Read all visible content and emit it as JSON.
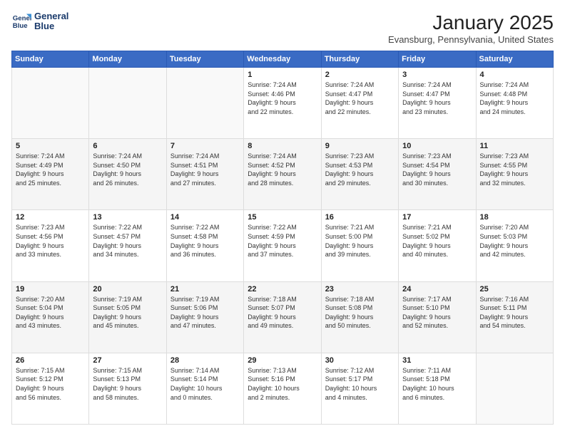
{
  "header": {
    "logo_line1": "General",
    "logo_line2": "Blue",
    "title": "January 2025",
    "subtitle": "Evansburg, Pennsylvania, United States"
  },
  "days_of_week": [
    "Sunday",
    "Monday",
    "Tuesday",
    "Wednesday",
    "Thursday",
    "Friday",
    "Saturday"
  ],
  "weeks": [
    [
      {
        "day": "",
        "details": ""
      },
      {
        "day": "",
        "details": ""
      },
      {
        "day": "",
        "details": ""
      },
      {
        "day": "1",
        "details": "Sunrise: 7:24 AM\nSunset: 4:46 PM\nDaylight: 9 hours\nand 22 minutes."
      },
      {
        "day": "2",
        "details": "Sunrise: 7:24 AM\nSunset: 4:47 PM\nDaylight: 9 hours\nand 22 minutes."
      },
      {
        "day": "3",
        "details": "Sunrise: 7:24 AM\nSunset: 4:47 PM\nDaylight: 9 hours\nand 23 minutes."
      },
      {
        "day": "4",
        "details": "Sunrise: 7:24 AM\nSunset: 4:48 PM\nDaylight: 9 hours\nand 24 minutes."
      }
    ],
    [
      {
        "day": "5",
        "details": "Sunrise: 7:24 AM\nSunset: 4:49 PM\nDaylight: 9 hours\nand 25 minutes."
      },
      {
        "day": "6",
        "details": "Sunrise: 7:24 AM\nSunset: 4:50 PM\nDaylight: 9 hours\nand 26 minutes."
      },
      {
        "day": "7",
        "details": "Sunrise: 7:24 AM\nSunset: 4:51 PM\nDaylight: 9 hours\nand 27 minutes."
      },
      {
        "day": "8",
        "details": "Sunrise: 7:24 AM\nSunset: 4:52 PM\nDaylight: 9 hours\nand 28 minutes."
      },
      {
        "day": "9",
        "details": "Sunrise: 7:23 AM\nSunset: 4:53 PM\nDaylight: 9 hours\nand 29 minutes."
      },
      {
        "day": "10",
        "details": "Sunrise: 7:23 AM\nSunset: 4:54 PM\nDaylight: 9 hours\nand 30 minutes."
      },
      {
        "day": "11",
        "details": "Sunrise: 7:23 AM\nSunset: 4:55 PM\nDaylight: 9 hours\nand 32 minutes."
      }
    ],
    [
      {
        "day": "12",
        "details": "Sunrise: 7:23 AM\nSunset: 4:56 PM\nDaylight: 9 hours\nand 33 minutes."
      },
      {
        "day": "13",
        "details": "Sunrise: 7:22 AM\nSunset: 4:57 PM\nDaylight: 9 hours\nand 34 minutes."
      },
      {
        "day": "14",
        "details": "Sunrise: 7:22 AM\nSunset: 4:58 PM\nDaylight: 9 hours\nand 36 minutes."
      },
      {
        "day": "15",
        "details": "Sunrise: 7:22 AM\nSunset: 4:59 PM\nDaylight: 9 hours\nand 37 minutes."
      },
      {
        "day": "16",
        "details": "Sunrise: 7:21 AM\nSunset: 5:00 PM\nDaylight: 9 hours\nand 39 minutes."
      },
      {
        "day": "17",
        "details": "Sunrise: 7:21 AM\nSunset: 5:02 PM\nDaylight: 9 hours\nand 40 minutes."
      },
      {
        "day": "18",
        "details": "Sunrise: 7:20 AM\nSunset: 5:03 PM\nDaylight: 9 hours\nand 42 minutes."
      }
    ],
    [
      {
        "day": "19",
        "details": "Sunrise: 7:20 AM\nSunset: 5:04 PM\nDaylight: 9 hours\nand 43 minutes."
      },
      {
        "day": "20",
        "details": "Sunrise: 7:19 AM\nSunset: 5:05 PM\nDaylight: 9 hours\nand 45 minutes."
      },
      {
        "day": "21",
        "details": "Sunrise: 7:19 AM\nSunset: 5:06 PM\nDaylight: 9 hours\nand 47 minutes."
      },
      {
        "day": "22",
        "details": "Sunrise: 7:18 AM\nSunset: 5:07 PM\nDaylight: 9 hours\nand 49 minutes."
      },
      {
        "day": "23",
        "details": "Sunrise: 7:18 AM\nSunset: 5:08 PM\nDaylight: 9 hours\nand 50 minutes."
      },
      {
        "day": "24",
        "details": "Sunrise: 7:17 AM\nSunset: 5:10 PM\nDaylight: 9 hours\nand 52 minutes."
      },
      {
        "day": "25",
        "details": "Sunrise: 7:16 AM\nSunset: 5:11 PM\nDaylight: 9 hours\nand 54 minutes."
      }
    ],
    [
      {
        "day": "26",
        "details": "Sunrise: 7:15 AM\nSunset: 5:12 PM\nDaylight: 9 hours\nand 56 minutes."
      },
      {
        "day": "27",
        "details": "Sunrise: 7:15 AM\nSunset: 5:13 PM\nDaylight: 9 hours\nand 58 minutes."
      },
      {
        "day": "28",
        "details": "Sunrise: 7:14 AM\nSunset: 5:14 PM\nDaylight: 10 hours\nand 0 minutes."
      },
      {
        "day": "29",
        "details": "Sunrise: 7:13 AM\nSunset: 5:16 PM\nDaylight: 10 hours\nand 2 minutes."
      },
      {
        "day": "30",
        "details": "Sunrise: 7:12 AM\nSunset: 5:17 PM\nDaylight: 10 hours\nand 4 minutes."
      },
      {
        "day": "31",
        "details": "Sunrise: 7:11 AM\nSunset: 5:18 PM\nDaylight: 10 hours\nand 6 minutes."
      },
      {
        "day": "",
        "details": ""
      }
    ]
  ]
}
